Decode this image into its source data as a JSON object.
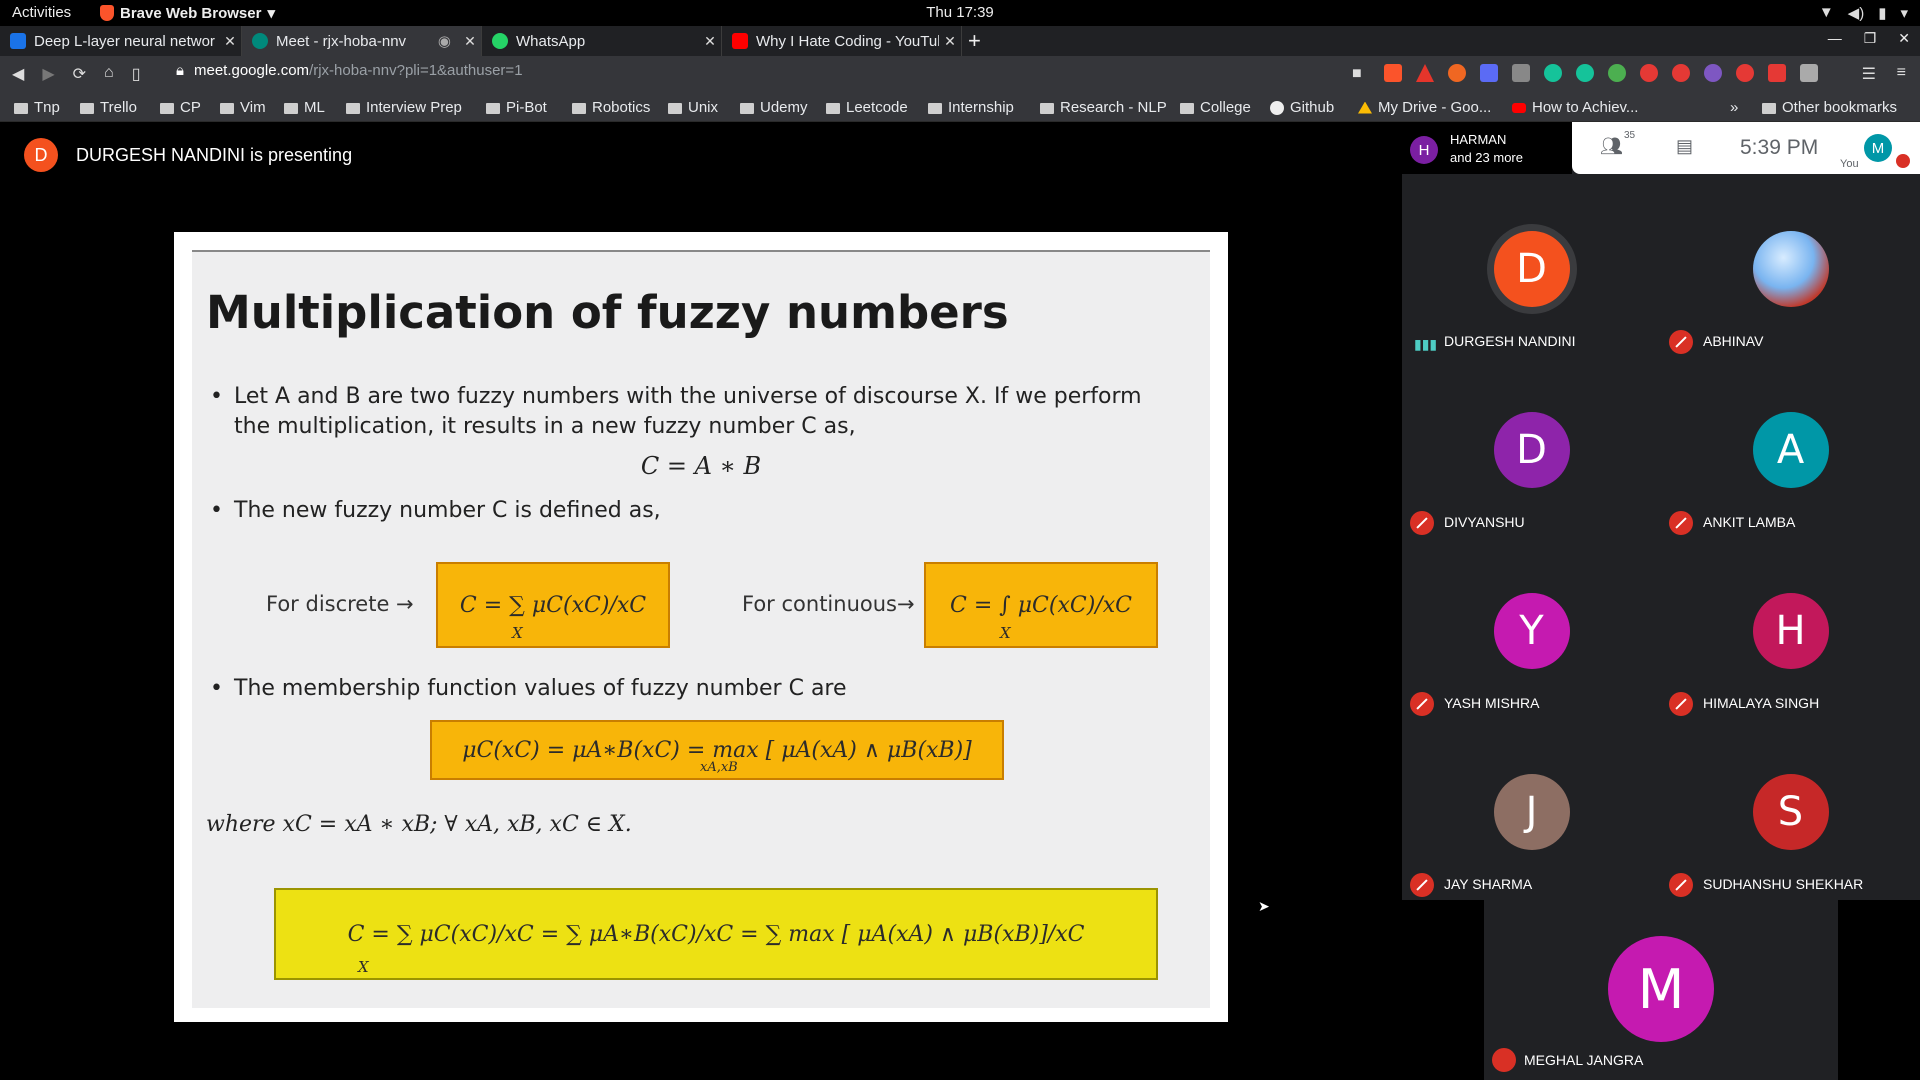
{
  "topbar": {
    "activities": "Activities",
    "app_name": "Brave Web Browser",
    "clock": "Thu 17:39"
  },
  "tabs": [
    {
      "title": "Deep L-layer neural networ",
      "icon": "infinity-icon",
      "color": "#1a73e8"
    },
    {
      "title": "Meet - rjx-hoba-nnv",
      "icon": "meet-icon",
      "color": "#00897b"
    },
    {
      "title": "WhatsApp",
      "icon": "whatsapp-icon",
      "color": "#25d366"
    },
    {
      "title": "Why I Hate Coding - YouTub",
      "icon": "youtube-icon",
      "color": "#ff0000"
    }
  ],
  "toolbar": {
    "url_host": "meet.google.com",
    "url_path": "/rjx-hoba-nnv?pli=1&authuser=1"
  },
  "bookmarks": [
    "Tnp",
    "Trello",
    "CP",
    "Vim",
    "ML",
    "Interview Prep",
    "Pi-Bot",
    "Robotics",
    "Unix",
    "Udemy",
    "Leetcode",
    "Internship",
    "Research - NLP",
    "College",
    "Github",
    "My Drive - Goo...",
    "How to Achiev...",
    "Other bookmarks"
  ],
  "presenting": {
    "initial": "D",
    "text": "DURGESH NANDINI is presenting"
  },
  "slide": {
    "title": "Multiplication of fuzzy numbers",
    "bullet1_line1": "Let A and B are two fuzzy numbers with the universe of discourse X. If we perform",
    "bullet1_line2": "the multiplication, it results in a new fuzzy number C as,",
    "eq1": "C = A ∗ B",
    "bullet2": "The new fuzzy number C is defined as,",
    "discrete_label": "For discrete →",
    "discrete_formula": "C = ∑ μC(xC)/xC",
    "discrete_sub": "X",
    "continuous_label": "For continuous→",
    "continuous_formula": "C = ∫ μC(xC)/xC",
    "continuous_sub": "X",
    "bullet3": "The membership function values of fuzzy number C are",
    "membership_formula": "μC(xC) = μA∗B(xC) = max [ μA(xA) ∧ μB(xB)]",
    "membership_sub": "xA,xB",
    "where": "where xC = xA ∗ xB; ∀ xA, xB, xC ∈ X.",
    "final_formula": "C = ∑ μC(xC)/xC = ∑ μA∗B(xC)/xC = ∑ max [ μA(xA) ∧ μB(xB)]/xC",
    "final_sub": "X"
  },
  "right_top": {
    "avatar": "H",
    "name": "HARMAN",
    "more": "and 23 more",
    "people_count": "35",
    "time": "5:39 PM",
    "you": "You",
    "self_initial": "M"
  },
  "participants": [
    {
      "initial": "D",
      "name": "DURGESH NANDINI",
      "color": "#f4511e",
      "speaking": true
    },
    {
      "initial": "",
      "name": "ABHINAV",
      "color": "#4a90d9",
      "speaking": false
    },
    {
      "initial": "D",
      "name": "DIVYANSHU",
      "color": "#8e24aa",
      "speaking": false
    },
    {
      "initial": "A",
      "name": "ANKIT LAMBA",
      "color": "#0097a7",
      "speaking": false
    },
    {
      "initial": "Y",
      "name": "YASH MISHRA",
      "color": "#c51ab0",
      "speaking": false
    },
    {
      "initial": "H",
      "name": "HIMALAYA SINGH",
      "color": "#c2185b",
      "speaking": false
    },
    {
      "initial": "J",
      "name": "JAY SHARMA",
      "color": "#8d6e63",
      "speaking": false
    },
    {
      "initial": "S",
      "name": "SUDHANSHU SHEKHAR",
      "color": "#c62828",
      "speaking": false
    },
    {
      "initial": "M",
      "name": "MEGHAL JANGRA",
      "color": "#c51ab0",
      "speaking": false
    }
  ]
}
